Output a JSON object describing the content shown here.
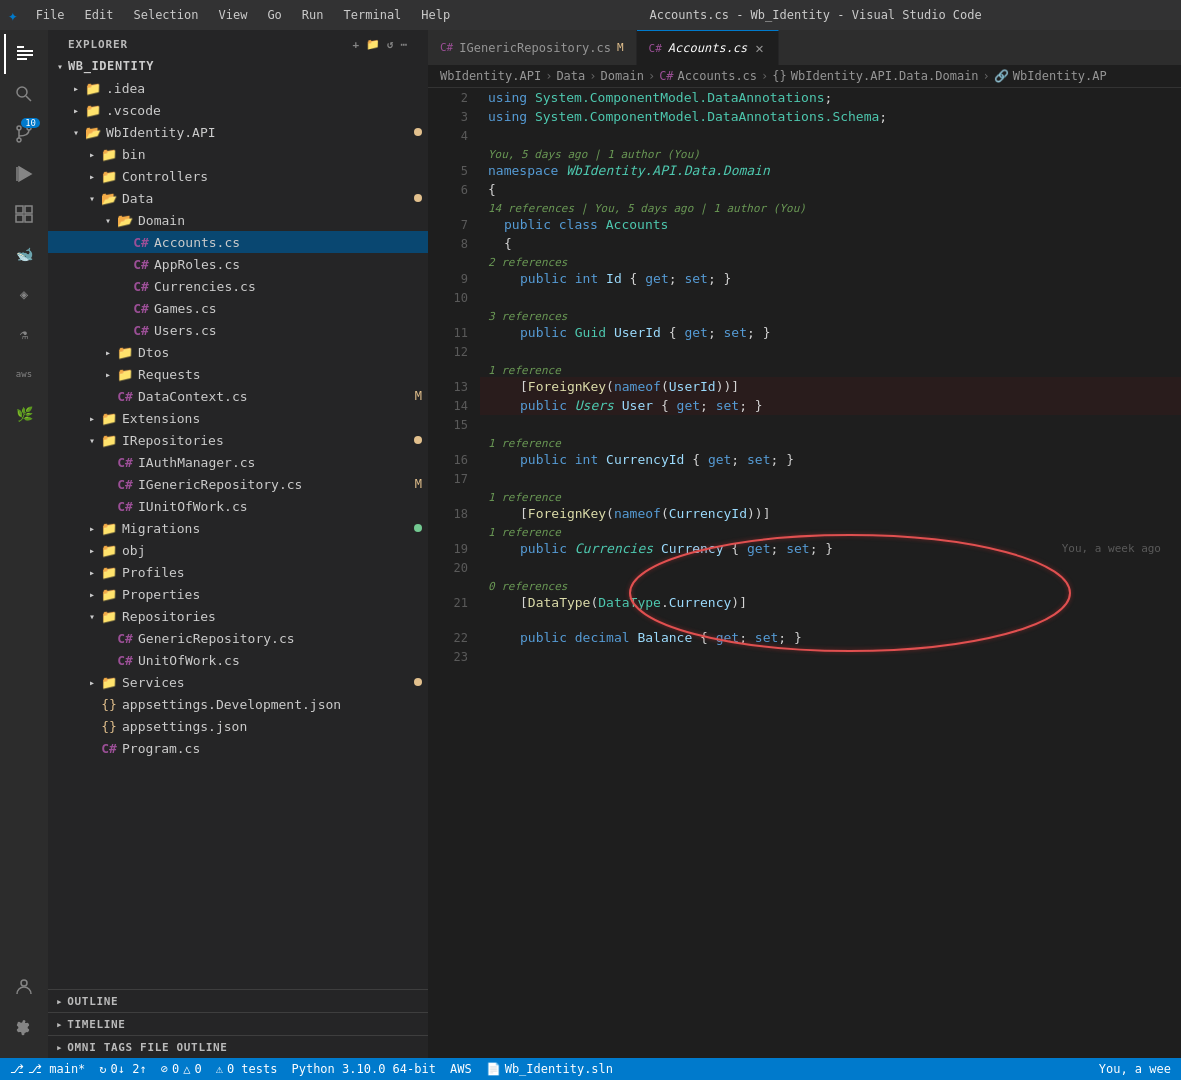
{
  "titleBar": {
    "logo": "⬡",
    "menu": [
      "File",
      "Edit",
      "Selection",
      "View",
      "Go",
      "Run",
      "Terminal",
      "Help"
    ],
    "title": "Accounts.cs - Wb_Identity - Visual Studio Code"
  },
  "activityBar": {
    "icons": [
      {
        "name": "explorer-icon",
        "symbol": "⎘",
        "active": true
      },
      {
        "name": "search-icon",
        "symbol": "🔍"
      },
      {
        "name": "source-control-icon",
        "symbol": "⑂",
        "badge": "10"
      },
      {
        "name": "run-debug-icon",
        "symbol": "▷"
      },
      {
        "name": "extensions-icon",
        "symbol": "⊞"
      },
      {
        "name": "docker-icon",
        "symbol": "🐋"
      },
      {
        "name": "database-icon",
        "symbol": "⬡"
      },
      {
        "name": "flask-icon",
        "symbol": "⚗"
      },
      {
        "name": "aws-icon",
        "symbol": "aws"
      },
      {
        "name": "leaf-icon",
        "symbol": "🌿"
      }
    ],
    "bottomIcons": [
      {
        "name": "account-icon",
        "symbol": "👤"
      },
      {
        "name": "settings-icon",
        "symbol": "⚙"
      }
    ]
  },
  "sidebar": {
    "headerLabel": "EXPLORER",
    "headerMenuSymbol": "⋯",
    "tree": [
      {
        "id": "wb-identity-root",
        "label": "WB_IDENTITY",
        "level": 0,
        "open": true,
        "type": "root"
      },
      {
        "id": "idea-folder",
        "label": ".idea",
        "level": 1,
        "open": false,
        "type": "folder"
      },
      {
        "id": "vscode-folder",
        "label": ".vscode",
        "level": 1,
        "open": false,
        "type": "folder"
      },
      {
        "id": "wbidentity-api-folder",
        "label": "WbIdentity.API",
        "level": 1,
        "open": true,
        "type": "folder-special",
        "status": "dot"
      },
      {
        "id": "bin-folder",
        "label": "bin",
        "level": 2,
        "open": false,
        "type": "folder"
      },
      {
        "id": "controllers-folder",
        "label": "Controllers",
        "level": 2,
        "open": false,
        "type": "folder"
      },
      {
        "id": "data-folder",
        "label": "Data",
        "level": 2,
        "open": true,
        "type": "folder-special",
        "status": "dot"
      },
      {
        "id": "domain-folder",
        "label": "Domain",
        "level": 3,
        "open": true,
        "type": "folder-special"
      },
      {
        "id": "accounts-cs",
        "label": "Accounts.cs",
        "level": 4,
        "type": "csharp",
        "selected": true
      },
      {
        "id": "approles-cs",
        "label": "AppRoles.cs",
        "level": 4,
        "type": "csharp"
      },
      {
        "id": "currencies-cs",
        "label": "Currencies.cs",
        "level": 4,
        "type": "csharp"
      },
      {
        "id": "games-cs",
        "label": "Games.cs",
        "level": 4,
        "type": "csharp"
      },
      {
        "id": "users-cs",
        "label": "Users.cs",
        "level": 4,
        "type": "csharp"
      },
      {
        "id": "dtos-folder",
        "label": "Dtos",
        "level": 3,
        "open": false,
        "type": "folder"
      },
      {
        "id": "requests-folder",
        "label": "Requests",
        "level": 3,
        "open": false,
        "type": "folder"
      },
      {
        "id": "datacontext-cs",
        "label": "DataContext.cs",
        "level": 3,
        "type": "csharp",
        "status": "M"
      },
      {
        "id": "extensions-folder",
        "label": "Extensions",
        "level": 2,
        "open": false,
        "type": "folder-special"
      },
      {
        "id": "irepositories-folder",
        "label": "IRepositories",
        "level": 2,
        "open": true,
        "type": "folder",
        "status": "dot"
      },
      {
        "id": "iauthmanager-cs",
        "label": "IAuthManager.cs",
        "level": 3,
        "type": "csharp"
      },
      {
        "id": "igenericrepository-cs",
        "label": "IGenericRepository.cs",
        "level": 3,
        "type": "csharp",
        "status": "M"
      },
      {
        "id": "iunitofwork-cs",
        "label": "IUnitOfWork.cs",
        "level": 3,
        "type": "csharp"
      },
      {
        "id": "migrations-folder",
        "label": "Migrations",
        "level": 2,
        "open": false,
        "type": "folder",
        "status": "dot-green"
      },
      {
        "id": "obj-folder",
        "label": "obj",
        "level": 2,
        "open": false,
        "type": "folder"
      },
      {
        "id": "profiles-folder",
        "label": "Profiles",
        "level": 2,
        "open": false,
        "type": "folder"
      },
      {
        "id": "properties-folder",
        "label": "Properties",
        "level": 2,
        "open": false,
        "type": "folder"
      },
      {
        "id": "repositories-folder",
        "label": "Repositories",
        "level": 2,
        "open": true,
        "type": "folder"
      },
      {
        "id": "genericrepository-cs",
        "label": "GenericRepository.cs",
        "level": 3,
        "type": "csharp"
      },
      {
        "id": "unitofwork-cs",
        "label": "UnitOfWork.cs",
        "level": 3,
        "type": "csharp"
      },
      {
        "id": "services-folder",
        "label": "Services",
        "level": 2,
        "open": false,
        "type": "folder-special",
        "status": "dot"
      },
      {
        "id": "appsettings-dev-json",
        "label": "appsettings.Development.json",
        "level": 2,
        "type": "json"
      },
      {
        "id": "appsettings-json",
        "label": "appsettings.json",
        "level": 2,
        "type": "json"
      },
      {
        "id": "program-cs",
        "label": "Program.cs",
        "level": 2,
        "type": "csharp"
      }
    ],
    "bottomSections": [
      {
        "id": "outline-section",
        "label": "OUTLINE"
      },
      {
        "id": "timeline-section",
        "label": "TIMELINE"
      },
      {
        "id": "omni-tags-section",
        "label": "OMNI TAGS FILE OUTLINE"
      }
    ]
  },
  "tabs": [
    {
      "id": "igenericrepository-tab",
      "label": "IGenericRepository.cs",
      "lang": "C#",
      "modified": true,
      "active": false
    },
    {
      "id": "accounts-tab",
      "label": "Accounts.cs",
      "lang": "C#",
      "modified": false,
      "active": true
    }
  ],
  "breadcrumb": [
    "WbIdentity.API",
    "Data",
    "Domain",
    "C# Accounts.cs",
    "{} WbIdentity.API.Data.Domain",
    "🔗 WbIdentity.AP"
  ],
  "codeLines": [
    {
      "num": 2,
      "content": "using_system_component_data_annotations",
      "raw": "using System.ComponentModel.DataAnnotations;"
    },
    {
      "num": 3,
      "content": "using_schema",
      "raw": "using System.ComponentModel.DataAnnotations.Schema;"
    },
    {
      "num": 4,
      "content": "blank"
    },
    {
      "num": 5,
      "content": "namespace_line",
      "raw": "namespace WbIdentity.API.Data.Domain"
    },
    {
      "num": 6,
      "content": "open_brace"
    },
    {
      "num": 7,
      "content": "class_line",
      "raw": "    public class Accounts"
    },
    {
      "num": 8,
      "content": "open_brace2"
    },
    {
      "num": 9,
      "content": "id_prop",
      "raw": "        public int Id { get; set; }"
    },
    {
      "num": 10,
      "content": "blank"
    },
    {
      "num": 11,
      "content": "userid_prop",
      "raw": "        public Guid UserId { get; set; }"
    },
    {
      "num": 12,
      "content": "blank"
    },
    {
      "num": 13,
      "content": "foreignkey_attr",
      "raw": "        [ForeignKey(nameof(UserId))]"
    },
    {
      "num": 14,
      "content": "user_nav_prop",
      "raw": "        public Users User { get; set; }"
    },
    {
      "num": 15,
      "content": "blank"
    },
    {
      "num": 16,
      "content": "currencyid_prop",
      "raw": "        public int CurrencyId { get; set; }"
    },
    {
      "num": 17,
      "content": "blank"
    },
    {
      "num": 18,
      "content": "foreignkey_attr2",
      "raw": "        [ForeignKey(nameof(CurrencyId))]"
    },
    {
      "num": 19,
      "content": "currency_nav_prop",
      "raw": "        public Currencies Currency { get; set; }"
    },
    {
      "num": 20,
      "content": "blank"
    },
    {
      "num": 21,
      "content": "datatype_attr",
      "raw": "        [DataType(DataType.Currency)]"
    },
    {
      "num": 22,
      "content": "balance_prop",
      "raw": "        public decimal Balance { get; set; }"
    },
    {
      "num": 23,
      "content": "blank"
    }
  ],
  "hints": {
    "git_blame_19": "You, a week ago",
    "ref_2": "2 references",
    "ref_3": "3 references",
    "ref_1_a": "1 reference",
    "ref_1_b": "1 reference",
    "ref_14_refs": "14 references | You, 5 days ago | 1 author (You)",
    "git_author": "You, 5 days ago | 1 author (You)"
  },
  "statusBar": {
    "branch": "⎇ main*",
    "sync": "↻ 0↓ 2↑",
    "errors": "⊘ 0 △ 0",
    "python": "Python 3.10.0 64-bit",
    "aws": "AWS",
    "solution": "Wb_Identity.sln",
    "rightItems": [
      "You, a wee"
    ]
  }
}
